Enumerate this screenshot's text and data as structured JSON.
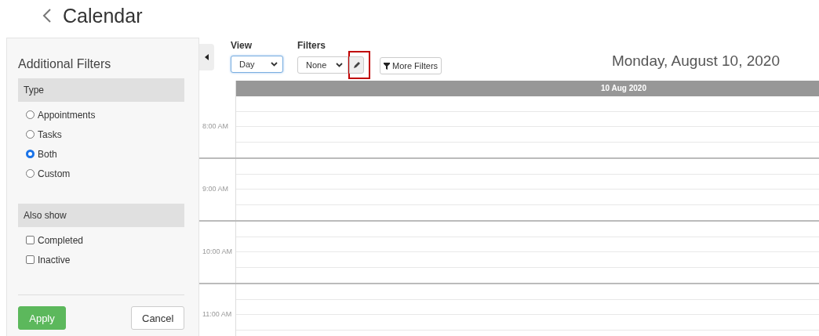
{
  "page": {
    "title": "Calendar"
  },
  "filters_panel": {
    "title": "Additional Filters",
    "sections": [
      {
        "heading": "Type",
        "kind": "radio",
        "options": [
          {
            "label": "Appointments",
            "selected": false
          },
          {
            "label": "Tasks",
            "selected": false
          },
          {
            "label": "Both",
            "selected": true
          },
          {
            "label": "Custom",
            "selected": false
          }
        ]
      },
      {
        "heading": "Also show",
        "kind": "checkbox",
        "options": [
          {
            "label": "Completed",
            "checked": false
          },
          {
            "label": "Inactive",
            "checked": false
          }
        ]
      }
    ],
    "buttons": [
      {
        "label": "Apply",
        "kind": "primary"
      },
      {
        "label": "Cancel",
        "kind": "secondary"
      }
    ]
  },
  "toolbar": {
    "view": {
      "label": "View",
      "value": "Day"
    },
    "filters": {
      "label": "Filters",
      "value": "None",
      "edit_highlighted": true
    },
    "more_filters": "More Filters"
  },
  "calendar": {
    "date_title": "Monday, August 10, 2020",
    "column_header": "10 Aug 2020",
    "times": [
      "8:00 AM",
      "9:00 AM",
      "10:00 AM",
      "11:00 AM"
    ]
  }
}
